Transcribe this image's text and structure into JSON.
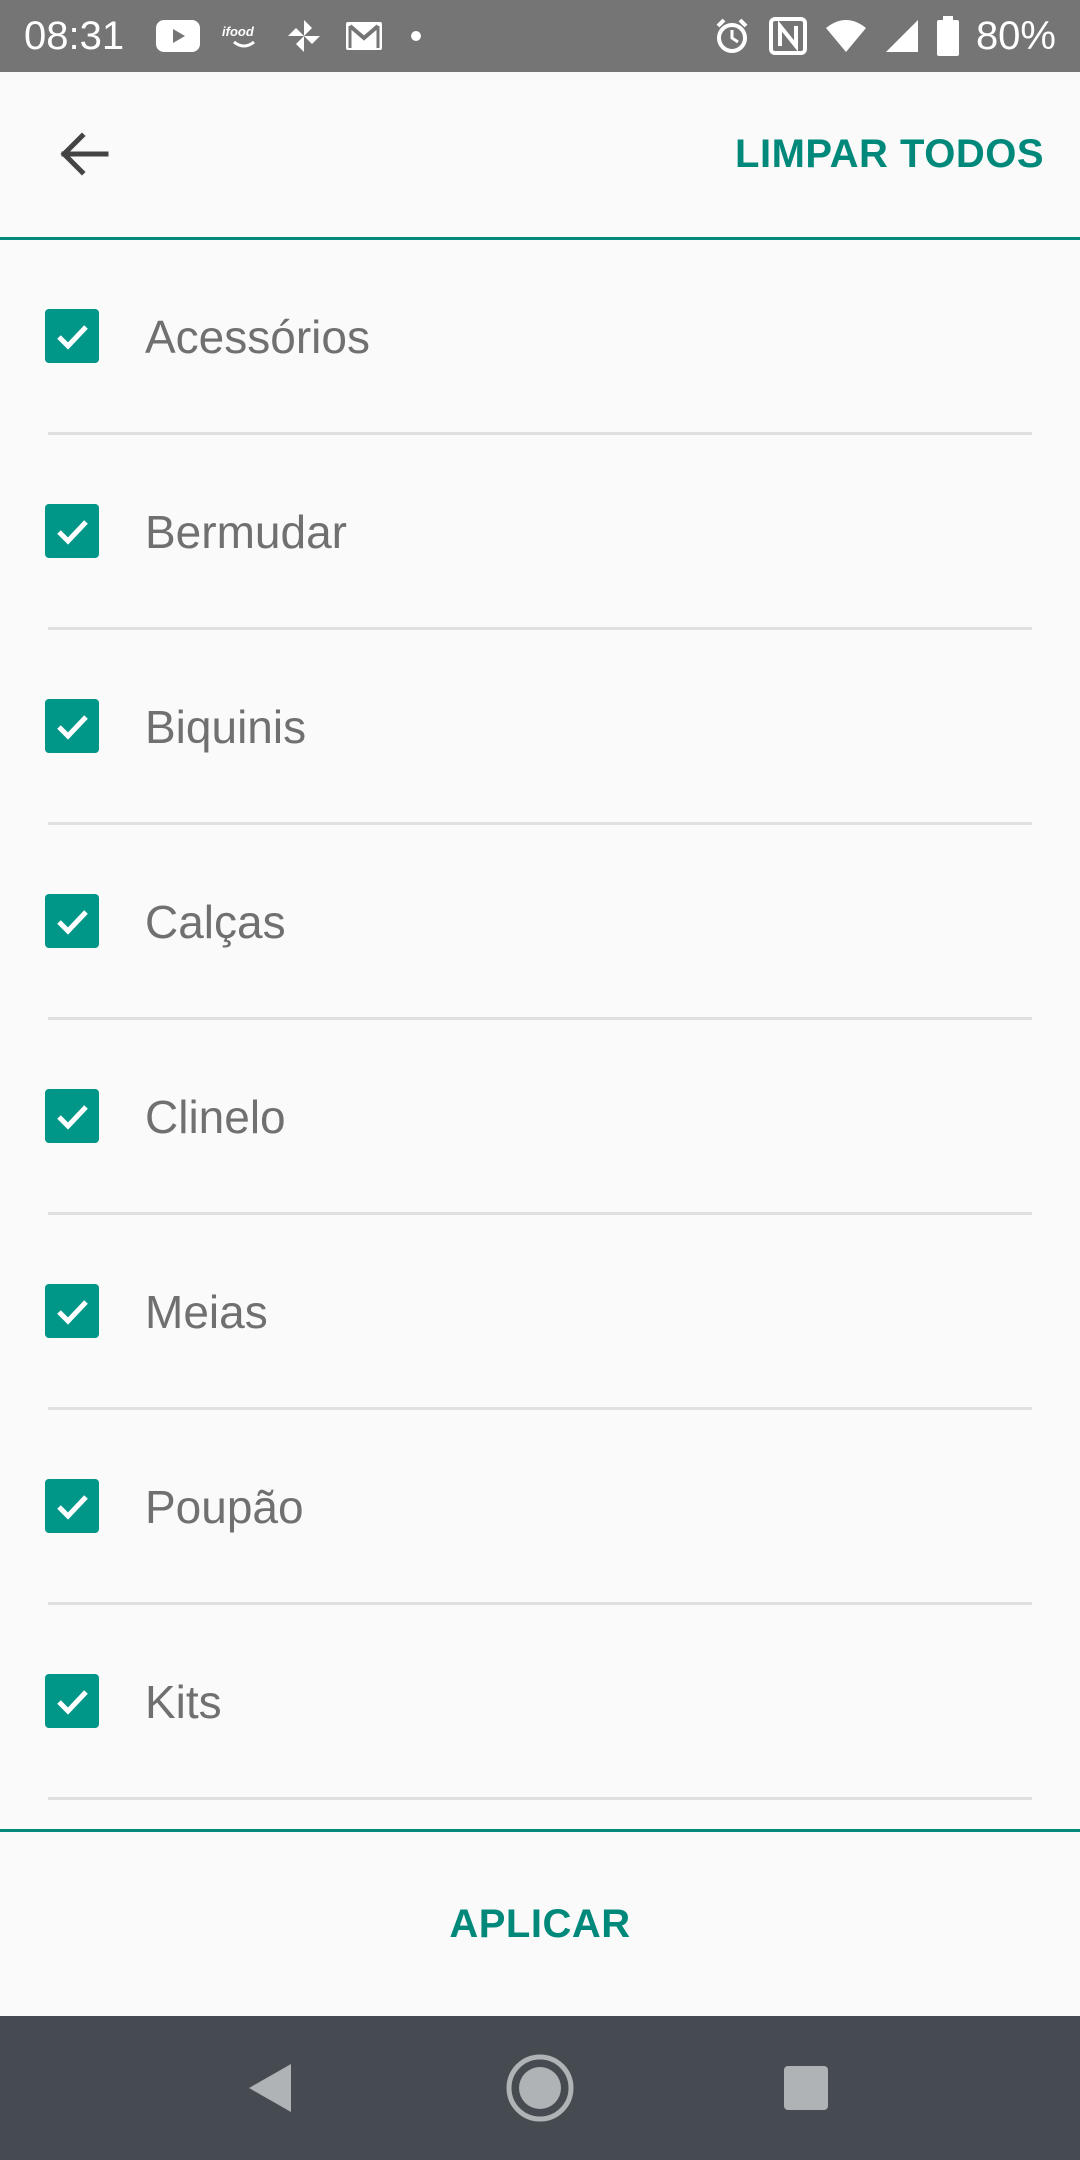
{
  "status_bar": {
    "time": "08:31",
    "battery_percent": "80%",
    "left_icons": [
      "youtube-icon",
      "ifood-icon",
      "pinwheel-icon",
      "gmail-icon",
      "dot-icon"
    ],
    "right_icons": [
      "alarm-icon",
      "nfc-icon",
      "wifi-icon",
      "signal-icon",
      "battery-icon"
    ],
    "background_color": "#757575"
  },
  "app_bar": {
    "back_icon": "arrow-left-icon",
    "clear_all_label": "LIMPAR TODOS"
  },
  "filter_list": {
    "items": [
      {
        "label": "Acessórios",
        "checked": true
      },
      {
        "label": "Bermudar",
        "checked": true
      },
      {
        "label": "Biquinis",
        "checked": true
      },
      {
        "label": "Calças",
        "checked": true
      },
      {
        "label": "Clinelo",
        "checked": true
      },
      {
        "label": "Meias",
        "checked": true
      },
      {
        "label": "Poupão",
        "checked": true
      },
      {
        "label": "Kits",
        "checked": true
      }
    ]
  },
  "bottom_bar": {
    "apply_label": "APLICAR"
  },
  "nav_bar": {
    "buttons": [
      "back-triangle-icon",
      "home-circle-icon",
      "recents-square-icon"
    ]
  },
  "colors": {
    "accent": "#00897b",
    "checkbox": "#009688",
    "text": "#707070",
    "divider": "#e0e0e0",
    "nav_bar": "#454b50"
  }
}
